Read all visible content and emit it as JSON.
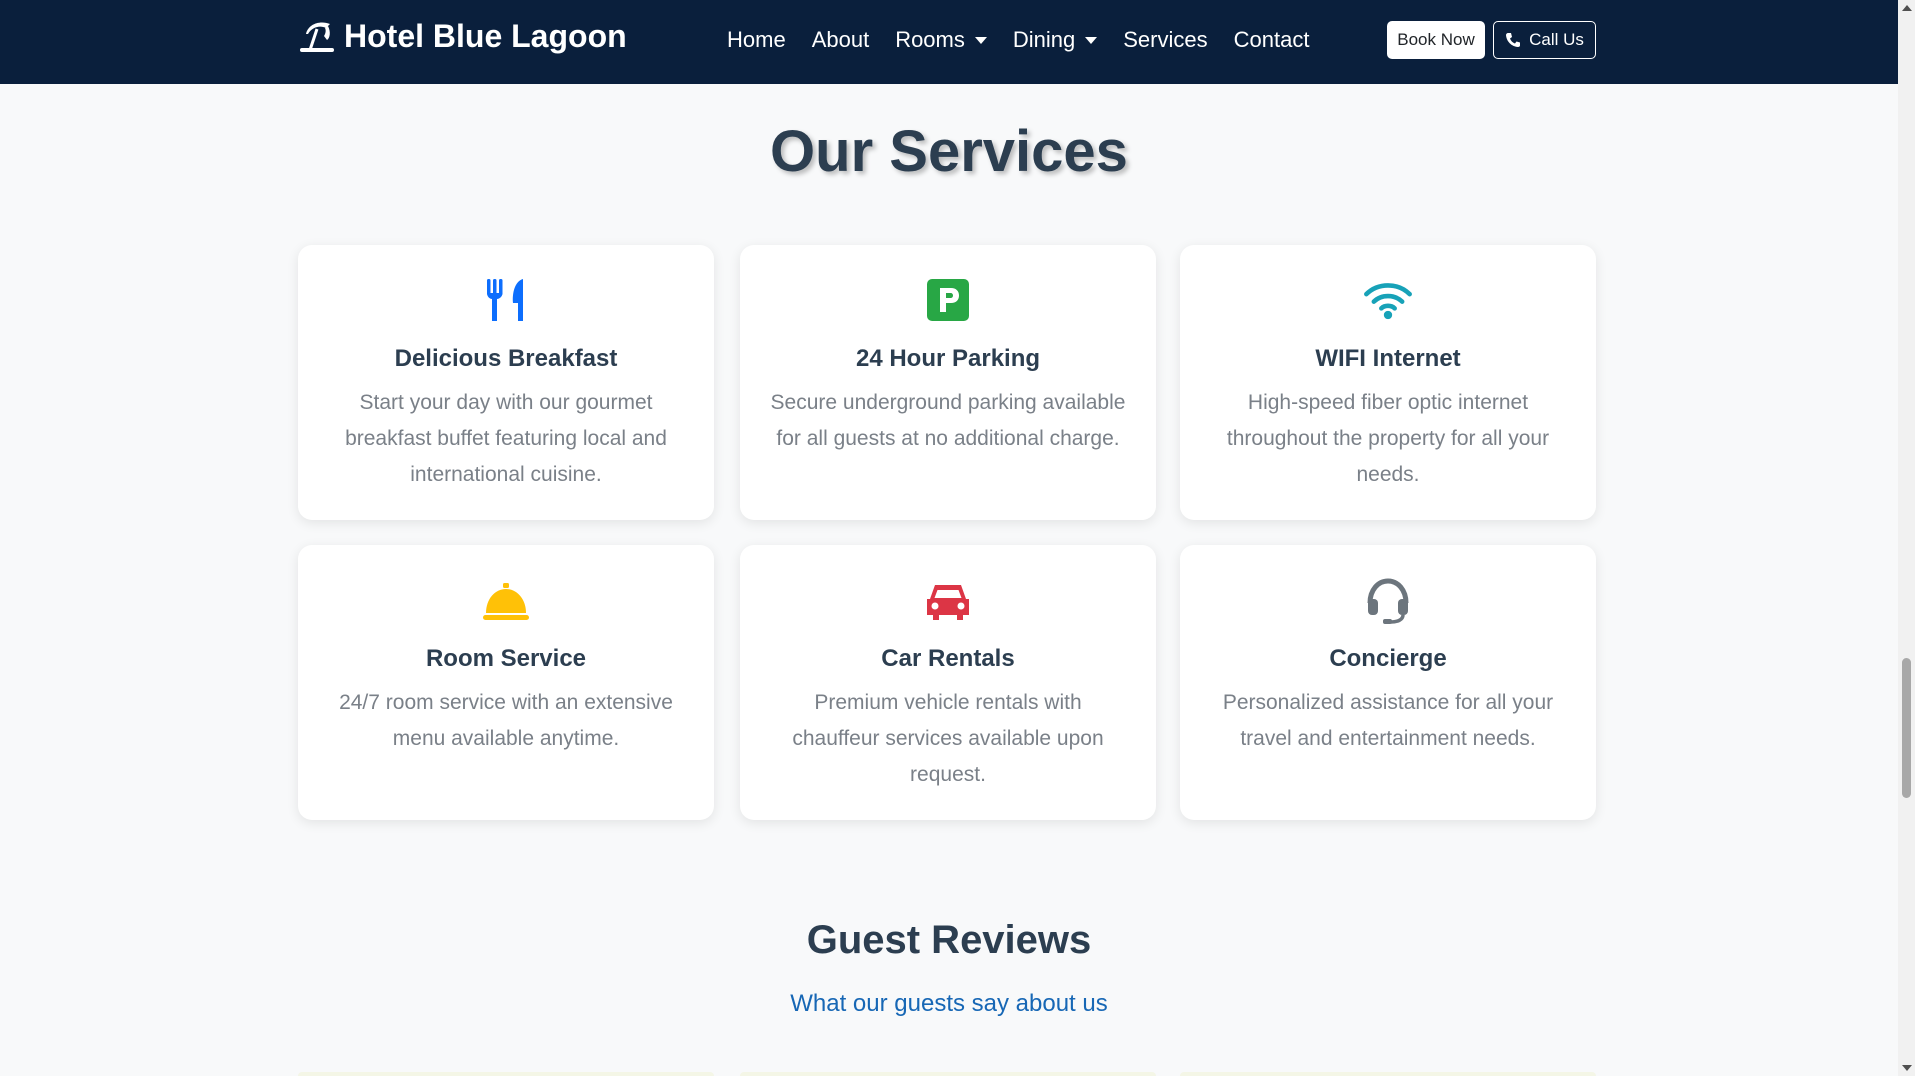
{
  "navbar": {
    "brand": "Hotel Blue Lagoon",
    "links": [
      {
        "label": "Home",
        "dropdown": false
      },
      {
        "label": "About",
        "dropdown": false
      },
      {
        "label": "Rooms",
        "dropdown": true
      },
      {
        "label": "Dining",
        "dropdown": true
      },
      {
        "label": "Services",
        "dropdown": false
      },
      {
        "label": "Contact",
        "dropdown": false
      }
    ],
    "book_label": "Book Now",
    "call_label": "Call Us"
  },
  "services": {
    "title": "Our Services",
    "items": [
      {
        "icon": "utensils-icon",
        "color": "#0d6efd",
        "title": "Delicious Breakfast",
        "text": "Start your day with our gourmet breakfast buffet featuring local and international cuisine."
      },
      {
        "icon": "parking-icon",
        "color": "#28a745",
        "title": "24 Hour Parking",
        "text": "Secure underground parking available for all guests at no additional charge."
      },
      {
        "icon": "wifi-icon",
        "color": "#17a2b8",
        "title": "WIFI Internet",
        "text": "High-speed fiber optic internet throughout the property for all your needs."
      },
      {
        "icon": "bell-icon",
        "color": "#ffc107",
        "title": "Room Service",
        "text": "24/7 room service with an extensive menu available anytime."
      },
      {
        "icon": "car-icon",
        "color": "#dc3545",
        "title": "Car Rentals",
        "text": "Premium vehicle rentals with chauffeur services available upon request."
      },
      {
        "icon": "headset-icon",
        "color": "#6c757d",
        "title": "Concierge",
        "text": "Personalized assistance for all your travel and entertainment needs."
      }
    ]
  },
  "reviews": {
    "title": "Guest Reviews",
    "subtitle": "What our guests say about us"
  }
}
